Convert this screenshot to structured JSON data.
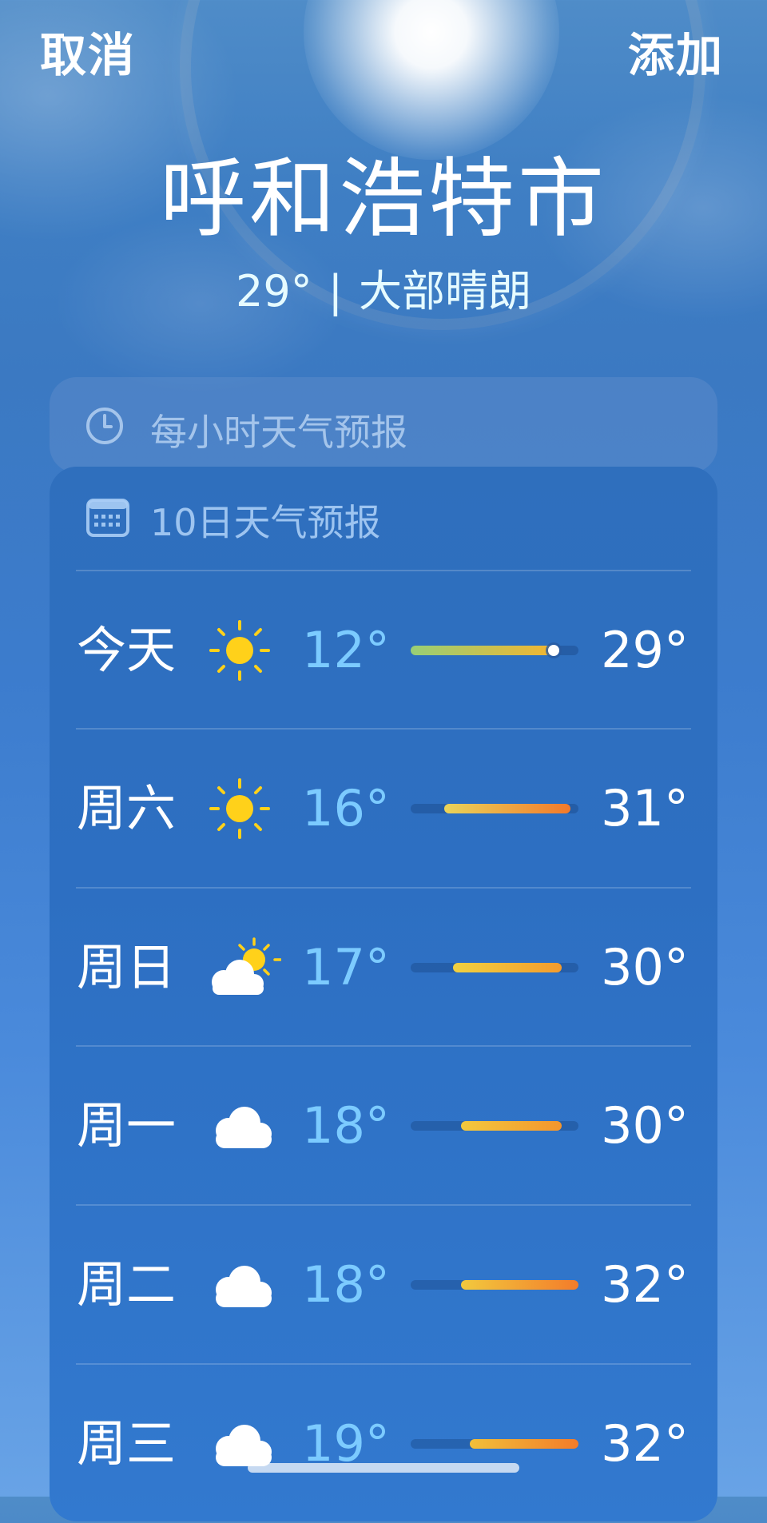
{
  "header": {
    "cancel_label": "取消",
    "add_label": "添加",
    "city": "呼和浩特市",
    "current_temp": "29°",
    "condition": "大部晴朗",
    "separator": "|"
  },
  "hourly_section": {
    "label": "每小时天气预报",
    "icon": "clock-icon"
  },
  "daily_section": {
    "label": "10日天气预报",
    "icon": "calendar-icon",
    "range_min": 12,
    "range_max": 32,
    "days": [
      {
        "day": "今天",
        "icon": "sun-icon",
        "low": "12°",
        "high": "29°",
        "low_value": 12,
        "high_value": 29,
        "current_value": 29,
        "color_start": "#98cf76",
        "color_end": "#f2b531"
      },
      {
        "day": "周六",
        "icon": "sun-icon",
        "low": "16°",
        "high": "31°",
        "low_value": 16,
        "high_value": 31,
        "color_start": "#e9d45a",
        "color_end": "#f2792b"
      },
      {
        "day": "周日",
        "icon": "partly-cloudy-icon",
        "low": "17°",
        "high": "30°",
        "low_value": 17,
        "high_value": 30,
        "color_start": "#f1d140",
        "color_end": "#f39b2e"
      },
      {
        "day": "周一",
        "icon": "cloud-icon",
        "low": "18°",
        "high": "30°",
        "low_value": 18,
        "high_value": 30,
        "color_start": "#f2c93e",
        "color_end": "#f3952d"
      },
      {
        "day": "周二",
        "icon": "cloud-icon",
        "low": "18°",
        "high": "32°",
        "low_value": 18,
        "high_value": 32,
        "color_start": "#f2c93e",
        "color_end": "#f37c2a"
      },
      {
        "day": "周三",
        "icon": "cloud-icon",
        "low": "19°",
        "high": "32°",
        "low_value": 19,
        "high_value": 32,
        "color_start": "#f2bf39",
        "color_end": "#f37c2a"
      }
    ]
  },
  "colors": {
    "low_temp": "#7ccbff",
    "sun": "#ffd11a",
    "cloud": "#ffffff"
  }
}
